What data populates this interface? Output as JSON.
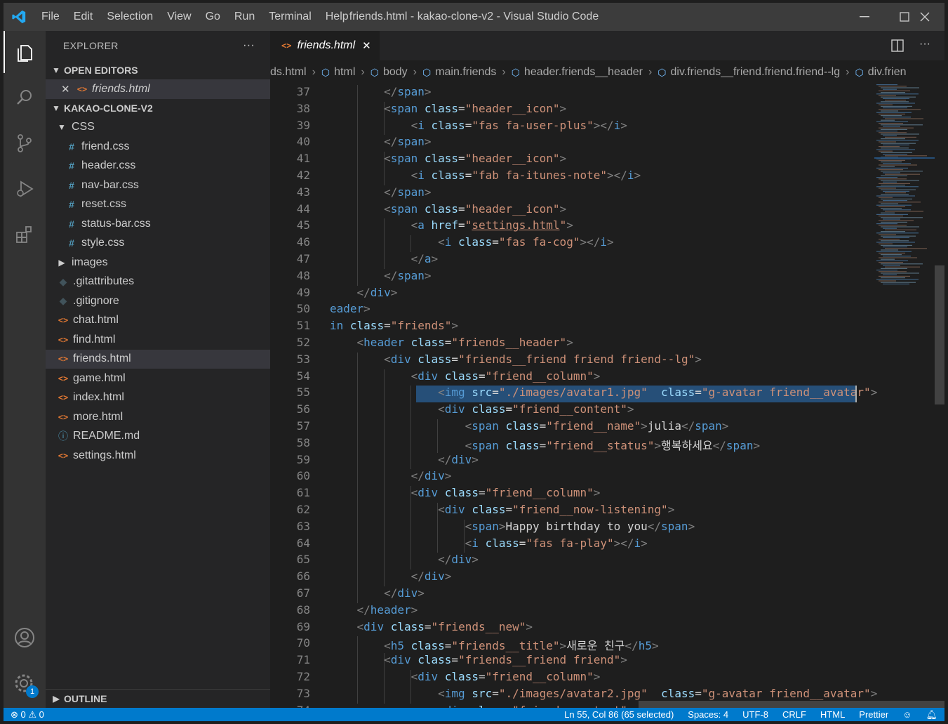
{
  "window": {
    "title": "friends.html - kakao-clone-v2 - Visual Studio Code"
  },
  "menu": [
    "File",
    "Edit",
    "Selection",
    "View",
    "Go",
    "Run",
    "Terminal",
    "Help"
  ],
  "activity_bar": [
    "files-icon",
    "search-icon",
    "source-control-icon",
    "run-debug-icon",
    "extensions-icon",
    "account-icon",
    "settings-gear-icon"
  ],
  "settings_badge": "1",
  "sidebar": {
    "title": "EXPLORER",
    "more": "···",
    "open_editors_label": "OPEN EDITORS",
    "open_editor_file": "friends.html",
    "project_label": "KAKAO-CLONE-V2",
    "tree": [
      {
        "label": "CSS",
        "kind": "folder-open",
        "depth": 1
      },
      {
        "label": "friend.css",
        "kind": "css",
        "depth": 2
      },
      {
        "label": "header.css",
        "kind": "css",
        "depth": 2
      },
      {
        "label": "nav-bar.css",
        "kind": "css",
        "depth": 2
      },
      {
        "label": "reset.css",
        "kind": "css",
        "depth": 2
      },
      {
        "label": "status-bar.css",
        "kind": "css",
        "depth": 2
      },
      {
        "label": "style.css",
        "kind": "css",
        "depth": 2
      },
      {
        "label": "images",
        "kind": "folder-closed",
        "depth": 1
      },
      {
        "label": ".gitattributes",
        "kind": "git",
        "depth": 1
      },
      {
        "label": ".gitignore",
        "kind": "git",
        "depth": 1
      },
      {
        "label": "chat.html",
        "kind": "html",
        "depth": 1
      },
      {
        "label": "find.html",
        "kind": "html",
        "depth": 1
      },
      {
        "label": "friends.html",
        "kind": "html",
        "depth": 1,
        "selected": true
      },
      {
        "label": "game.html",
        "kind": "html",
        "depth": 1
      },
      {
        "label": "index.html",
        "kind": "html",
        "depth": 1
      },
      {
        "label": "more.html",
        "kind": "html",
        "depth": 1
      },
      {
        "label": "README.md",
        "kind": "info",
        "depth": 1
      },
      {
        "label": "settings.html",
        "kind": "html",
        "depth": 1
      }
    ],
    "outline_label": "OUTLINE"
  },
  "editor": {
    "tab": "friends.html",
    "breadcrumbs": [
      "ds.html",
      "html",
      "body",
      "main.friends",
      "header.friends__header",
      "div.friends__friend.friend.friend--lg",
      "div.frien"
    ],
    "first_line": 37,
    "lines": [
      [
        [
          "        ",
          "x"
        ],
        [
          "</",
          "p"
        ],
        [
          "span",
          "t"
        ],
        [
          ">",
          "p"
        ]
      ],
      [
        [
          "        ",
          "x"
        ],
        [
          "<",
          "p"
        ],
        [
          "span",
          "t"
        ],
        [
          " ",
          "x"
        ],
        [
          "class",
          "a"
        ],
        [
          "=",
          "x"
        ],
        [
          "\"header__icon\"",
          "s"
        ],
        [
          ">",
          "p"
        ]
      ],
      [
        [
          "            ",
          "x"
        ],
        [
          "<",
          "p"
        ],
        [
          "i",
          "t"
        ],
        [
          " ",
          "x"
        ],
        [
          "class",
          "a"
        ],
        [
          "=",
          "x"
        ],
        [
          "\"fas fa-user-plus\"",
          "s"
        ],
        [
          "></",
          "p"
        ],
        [
          "i",
          "t"
        ],
        [
          ">",
          "p"
        ]
      ],
      [
        [
          "        ",
          "x"
        ],
        [
          "</",
          "p"
        ],
        [
          "span",
          "t"
        ],
        [
          ">",
          "p"
        ]
      ],
      [
        [
          "        ",
          "x"
        ],
        [
          "<",
          "p"
        ],
        [
          "span",
          "t"
        ],
        [
          " ",
          "x"
        ],
        [
          "class",
          "a"
        ],
        [
          "=",
          "x"
        ],
        [
          "\"header__icon\"",
          "s"
        ],
        [
          ">",
          "p"
        ]
      ],
      [
        [
          "            ",
          "x"
        ],
        [
          "<",
          "p"
        ],
        [
          "i",
          "t"
        ],
        [
          " ",
          "x"
        ],
        [
          "class",
          "a"
        ],
        [
          "=",
          "x"
        ],
        [
          "\"fab fa-itunes-note\"",
          "s"
        ],
        [
          "></",
          "p"
        ],
        [
          "i",
          "t"
        ],
        [
          ">",
          "p"
        ]
      ],
      [
        [
          "        ",
          "x"
        ],
        [
          "</",
          "p"
        ],
        [
          "span",
          "t"
        ],
        [
          ">",
          "p"
        ]
      ],
      [
        [
          "        ",
          "x"
        ],
        [
          "<",
          "p"
        ],
        [
          "span",
          "t"
        ],
        [
          " ",
          "x"
        ],
        [
          "class",
          "a"
        ],
        [
          "=",
          "x"
        ],
        [
          "\"header__icon\"",
          "s"
        ],
        [
          ">",
          "p"
        ]
      ],
      [
        [
          "            ",
          "x"
        ],
        [
          "<",
          "p"
        ],
        [
          "a",
          "t"
        ],
        [
          " ",
          "x"
        ],
        [
          "href",
          "a"
        ],
        [
          "=",
          "x"
        ],
        [
          "\"",
          "s"
        ],
        [
          "settings.html",
          "su"
        ],
        [
          "\"",
          "s"
        ],
        [
          ">",
          "p"
        ]
      ],
      [
        [
          "                ",
          "x"
        ],
        [
          "<",
          "p"
        ],
        [
          "i",
          "t"
        ],
        [
          " ",
          "x"
        ],
        [
          "class",
          "a"
        ],
        [
          "=",
          "x"
        ],
        [
          "\"fas fa-cog\"",
          "s"
        ],
        [
          "></",
          "p"
        ],
        [
          "i",
          "t"
        ],
        [
          ">",
          "p"
        ]
      ],
      [
        [
          "            ",
          "x"
        ],
        [
          "</",
          "p"
        ],
        [
          "a",
          "t"
        ],
        [
          ">",
          "p"
        ]
      ],
      [
        [
          "        ",
          "x"
        ],
        [
          "</",
          "p"
        ],
        [
          "span",
          "t"
        ],
        [
          ">",
          "p"
        ]
      ],
      [
        [
          "    ",
          "x"
        ],
        [
          "</",
          "p"
        ],
        [
          "div",
          "t"
        ],
        [
          ">",
          "p"
        ]
      ],
      [
        [
          "eader",
          "t"
        ],
        [
          ">",
          "p"
        ]
      ],
      [
        [
          "in",
          "t"
        ],
        [
          " ",
          "x"
        ],
        [
          "class",
          "a"
        ],
        [
          "=",
          "x"
        ],
        [
          "\"friends\"",
          "s"
        ],
        [
          ">",
          "p"
        ]
      ],
      [
        [
          "    ",
          "x"
        ],
        [
          "<",
          "p"
        ],
        [
          "header",
          "t"
        ],
        [
          " ",
          "x"
        ],
        [
          "class",
          "a"
        ],
        [
          "=",
          "x"
        ],
        [
          "\"friends__header\"",
          "s"
        ],
        [
          ">",
          "p"
        ]
      ],
      [
        [
          "        ",
          "x"
        ],
        [
          "<",
          "p"
        ],
        [
          "div",
          "t"
        ],
        [
          " ",
          "x"
        ],
        [
          "class",
          "a"
        ],
        [
          "=",
          "x"
        ],
        [
          "\"friends__friend friend friend--lg\"",
          "s"
        ],
        [
          ">",
          "p"
        ]
      ],
      [
        [
          "            ",
          "x"
        ],
        [
          "<",
          "p"
        ],
        [
          "div",
          "t"
        ],
        [
          " ",
          "x"
        ],
        [
          "class",
          "a"
        ],
        [
          "=",
          "x"
        ],
        [
          "\"friend__column\"",
          "s"
        ],
        [
          ">",
          "p"
        ]
      ],
      [
        [
          "                ",
          "x"
        ],
        [
          "<",
          "p"
        ],
        [
          "img",
          "t"
        ],
        [
          " ",
          "x"
        ],
        [
          "src",
          "a"
        ],
        [
          "=",
          "x"
        ],
        [
          "\"./images/avatar1.jpg\"",
          "s"
        ],
        [
          "  ",
          "x"
        ],
        [
          "class",
          "a"
        ],
        [
          "=",
          "x"
        ],
        [
          "\"g-avatar friend__avatar\"",
          "s"
        ],
        [
          ">",
          "p"
        ]
      ],
      [
        [
          "                ",
          "x"
        ],
        [
          "<",
          "p"
        ],
        [
          "div",
          "t"
        ],
        [
          " ",
          "x"
        ],
        [
          "class",
          "a"
        ],
        [
          "=",
          "x"
        ],
        [
          "\"friend__content\"",
          "s"
        ],
        [
          ">",
          "p"
        ]
      ],
      [
        [
          "                    ",
          "x"
        ],
        [
          "<",
          "p"
        ],
        [
          "span",
          "t"
        ],
        [
          " ",
          "x"
        ],
        [
          "class",
          "a"
        ],
        [
          "=",
          "x"
        ],
        [
          "\"friend__name\"",
          "s"
        ],
        [
          ">",
          "p"
        ],
        [
          "julia",
          "x"
        ],
        [
          "</",
          "p"
        ],
        [
          "span",
          "t"
        ],
        [
          ">",
          "p"
        ]
      ],
      [
        [
          "                    ",
          "x"
        ],
        [
          "<",
          "p"
        ],
        [
          "span",
          "t"
        ],
        [
          " ",
          "x"
        ],
        [
          "class",
          "a"
        ],
        [
          "=",
          "x"
        ],
        [
          "\"friend__status\"",
          "s"
        ],
        [
          ">",
          "p"
        ],
        [
          "행복하세요",
          "x"
        ],
        [
          "</",
          "p"
        ],
        [
          "span",
          "t"
        ],
        [
          ">",
          "p"
        ]
      ],
      [
        [
          "                ",
          "x"
        ],
        [
          "</",
          "p"
        ],
        [
          "div",
          "t"
        ],
        [
          ">",
          "p"
        ]
      ],
      [
        [
          "            ",
          "x"
        ],
        [
          "</",
          "p"
        ],
        [
          "div",
          "t"
        ],
        [
          ">",
          "p"
        ]
      ],
      [
        [
          "            ",
          "x"
        ],
        [
          "<",
          "p"
        ],
        [
          "div",
          "t"
        ],
        [
          " ",
          "x"
        ],
        [
          "class",
          "a"
        ],
        [
          "=",
          "x"
        ],
        [
          "\"friend__column\"",
          "s"
        ],
        [
          ">",
          "p"
        ]
      ],
      [
        [
          "                ",
          "x"
        ],
        [
          "<",
          "p"
        ],
        [
          "div",
          "t"
        ],
        [
          " ",
          "x"
        ],
        [
          "class",
          "a"
        ],
        [
          "=",
          "x"
        ],
        [
          "\"friend__now-listening\"",
          "s"
        ],
        [
          ">",
          "p"
        ]
      ],
      [
        [
          "                    ",
          "x"
        ],
        [
          "<",
          "p"
        ],
        [
          "span",
          "t"
        ],
        [
          ">",
          "p"
        ],
        [
          "Happy birthday to you",
          "x"
        ],
        [
          "</",
          "p"
        ],
        [
          "span",
          "t"
        ],
        [
          ">",
          "p"
        ]
      ],
      [
        [
          "                    ",
          "x"
        ],
        [
          "<",
          "p"
        ],
        [
          "i",
          "t"
        ],
        [
          " ",
          "x"
        ],
        [
          "class",
          "a"
        ],
        [
          "=",
          "x"
        ],
        [
          "\"fas fa-play\"",
          "s"
        ],
        [
          "></",
          "p"
        ],
        [
          "i",
          "t"
        ],
        [
          ">",
          "p"
        ]
      ],
      [
        [
          "                ",
          "x"
        ],
        [
          "</",
          "p"
        ],
        [
          "div",
          "t"
        ],
        [
          ">",
          "p"
        ]
      ],
      [
        [
          "            ",
          "x"
        ],
        [
          "</",
          "p"
        ],
        [
          "div",
          "t"
        ],
        [
          ">",
          "p"
        ]
      ],
      [
        [
          "        ",
          "x"
        ],
        [
          "</",
          "p"
        ],
        [
          "div",
          "t"
        ],
        [
          ">",
          "p"
        ]
      ],
      [
        [
          "    ",
          "x"
        ],
        [
          "</",
          "p"
        ],
        [
          "header",
          "t"
        ],
        [
          ">",
          "p"
        ]
      ],
      [
        [
          "    ",
          "x"
        ],
        [
          "<",
          "p"
        ],
        [
          "div",
          "t"
        ],
        [
          " ",
          "x"
        ],
        [
          "class",
          "a"
        ],
        [
          "=",
          "x"
        ],
        [
          "\"friends__new\"",
          "s"
        ],
        [
          ">",
          "p"
        ]
      ],
      [
        [
          "        ",
          "x"
        ],
        [
          "<",
          "p"
        ],
        [
          "h5",
          "t"
        ],
        [
          " ",
          "x"
        ],
        [
          "class",
          "a"
        ],
        [
          "=",
          "x"
        ],
        [
          "\"friends__title\"",
          "s"
        ],
        [
          ">",
          "p"
        ],
        [
          "새로운 친구",
          "x"
        ],
        [
          "</",
          "p"
        ],
        [
          "h5",
          "t"
        ],
        [
          ">",
          "p"
        ]
      ],
      [
        [
          "        ",
          "x"
        ],
        [
          "<",
          "p"
        ],
        [
          "div",
          "t"
        ],
        [
          " ",
          "x"
        ],
        [
          "class",
          "a"
        ],
        [
          "=",
          "x"
        ],
        [
          "\"friends__friend friend\"",
          "s"
        ],
        [
          ">",
          "p"
        ]
      ],
      [
        [
          "            ",
          "x"
        ],
        [
          "<",
          "p"
        ],
        [
          "div",
          "t"
        ],
        [
          " ",
          "x"
        ],
        [
          "class",
          "a"
        ],
        [
          "=",
          "x"
        ],
        [
          "\"friend__column\"",
          "s"
        ],
        [
          ">",
          "p"
        ]
      ],
      [
        [
          "                ",
          "x"
        ],
        [
          "<",
          "p"
        ],
        [
          "img",
          "t"
        ],
        [
          " ",
          "x"
        ],
        [
          "src",
          "a"
        ],
        [
          "=",
          "x"
        ],
        [
          "\"./images/avatar2.jpg\"",
          "s"
        ],
        [
          "  ",
          "x"
        ],
        [
          "class",
          "a"
        ],
        [
          "=",
          "x"
        ],
        [
          "\"g-avatar friend__avatar\"",
          "s"
        ],
        [
          ">",
          "p"
        ]
      ],
      [
        [
          "                ",
          "x"
        ],
        [
          "<",
          "p"
        ],
        [
          "div",
          "t"
        ],
        [
          " ",
          "x"
        ],
        [
          "class",
          "a"
        ],
        [
          "=",
          "x"
        ],
        [
          "\"friend__content\"",
          "s"
        ],
        [
          ">",
          "p"
        ]
      ]
    ]
  },
  "status": {
    "errors": "⊗ 0",
    "warnings": "⚠ 0",
    "position": "Ln 55, Col 86 (65 selected)",
    "spaces": "Spaces: 4",
    "encoding": "UTF-8",
    "eol": "CRLF",
    "language": "HTML",
    "formatter": "Prettier"
  }
}
